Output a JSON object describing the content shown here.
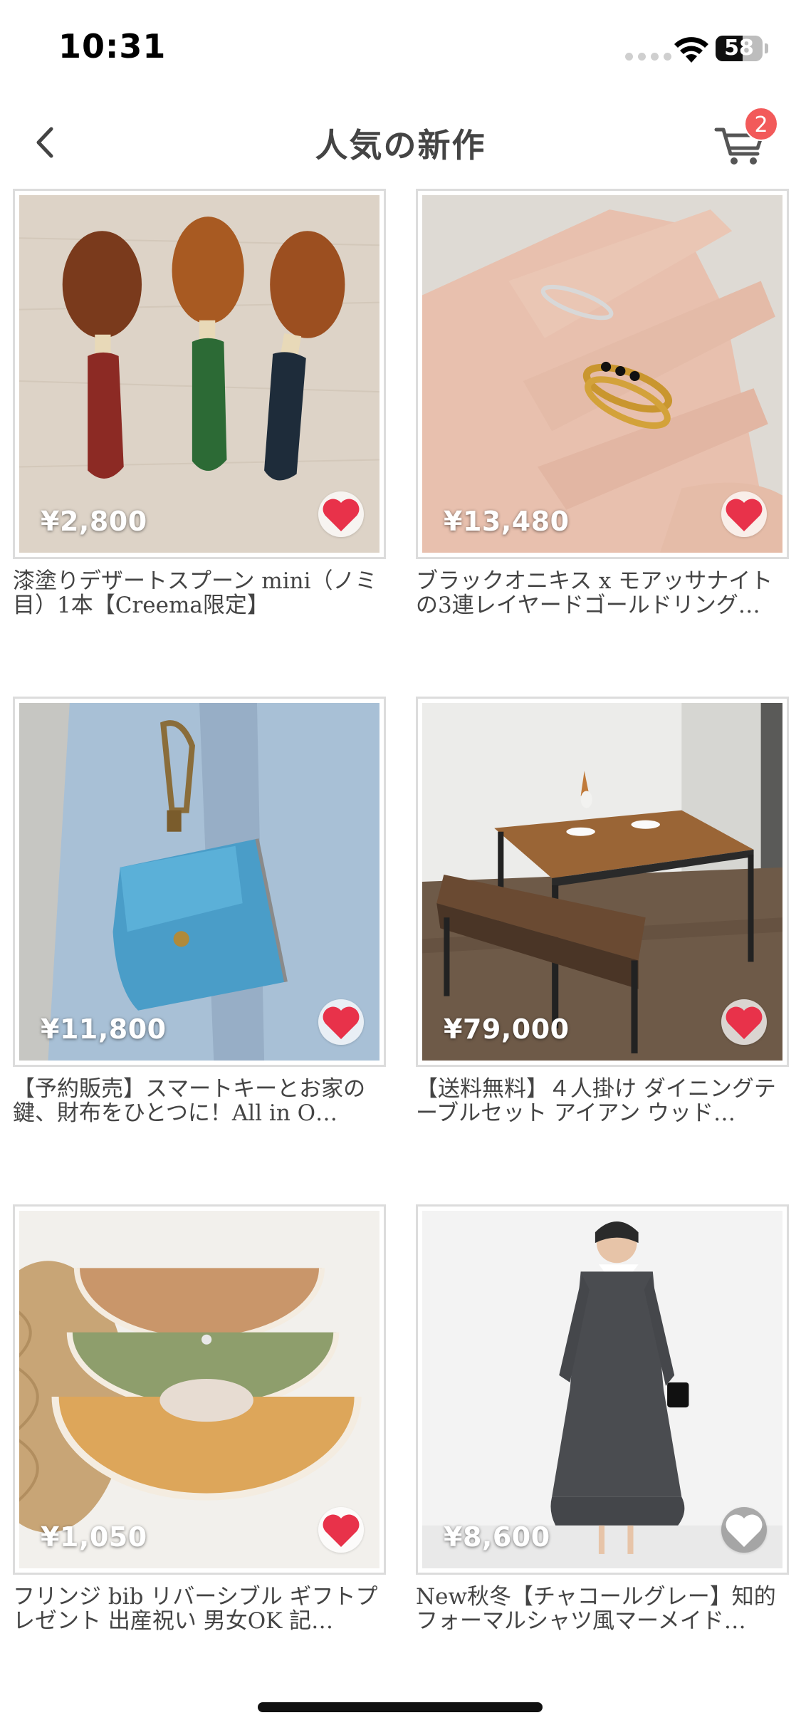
{
  "status_bar": {
    "time": "10:31",
    "battery": "58",
    "battery_level": 0.58
  },
  "nav": {
    "title": "人気の新作",
    "cart_badge": "2"
  },
  "products": [
    {
      "price": "¥2,800",
      "title": "漆塗りデザートスプーン mini（ノミ目）1本【Creema限定】",
      "favorited": true
    },
    {
      "price": "¥13,480",
      "title": "ブラックオニキス x モアッサナイトの3連レイヤードゴールドリング…",
      "favorited": true
    },
    {
      "price": "¥11,800",
      "title": "【予約販売】スマートキーとお家の鍵、財布をひとつに！All in O…",
      "favorited": true
    },
    {
      "price": "¥79,000",
      "title": "【送料無料】４人掛け ダイニングテーブルセット アイアン ウッド…",
      "favorited": true
    },
    {
      "price": "¥1,050",
      "title": "フリンジ bib リバーシブル ギフトプレゼント 出産祝い 男女OK 記…",
      "favorited": true
    },
    {
      "price": "¥8,600",
      "title": "New秋冬【チャコールグレー】知的フォーマルシャツ風マーメイド…",
      "favorited": false
    }
  ],
  "colors": {
    "accent": "#f25a5a",
    "heart": "#e8324a",
    "border": "#dcdcdc"
  },
  "icons": [
    "back-chevron-icon",
    "cart-icon",
    "heart-icon",
    "wifi-icon",
    "battery-icon"
  ]
}
